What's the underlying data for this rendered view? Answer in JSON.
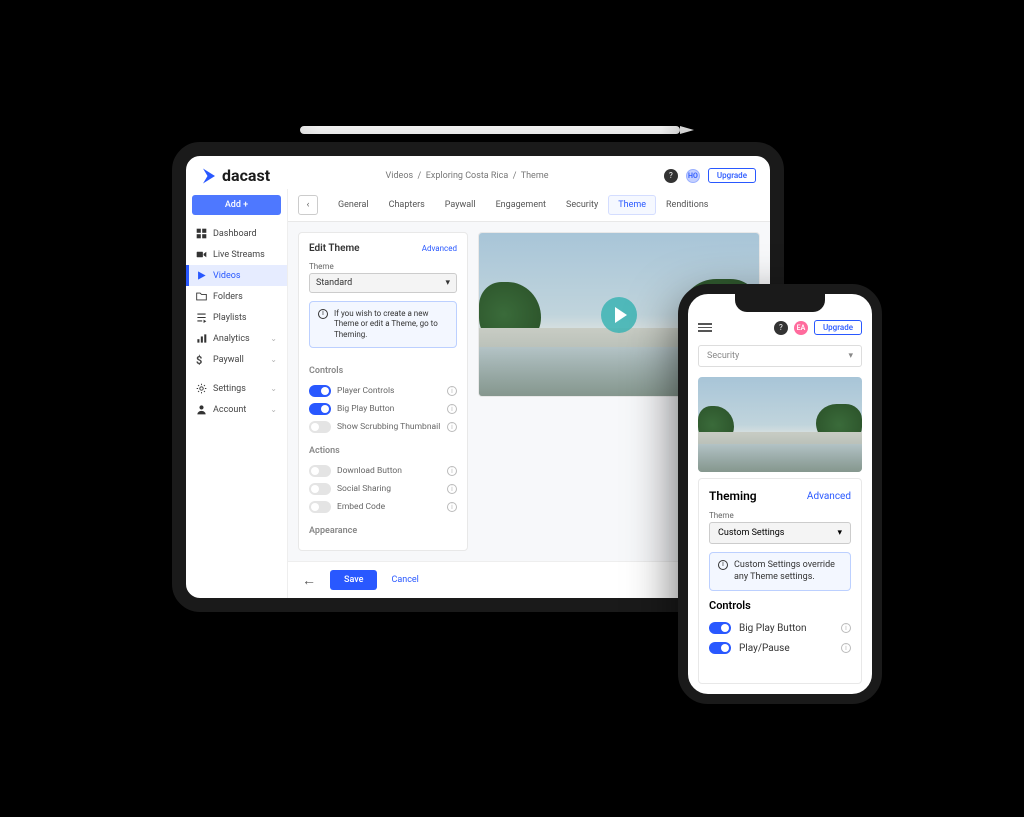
{
  "brand": "dacast",
  "breadcrumb": [
    "Videos",
    "Exploring Costa Rica",
    "Theme"
  ],
  "header": {
    "upgrade": "Upgrade",
    "user_initials": "HO"
  },
  "sidebar": {
    "add": "Add +",
    "items": [
      {
        "label": "Dashboard",
        "icon": "grid"
      },
      {
        "label": "Live Streams",
        "icon": "camera"
      },
      {
        "label": "Videos",
        "icon": "play",
        "active": true
      },
      {
        "label": "Folders",
        "icon": "folder"
      },
      {
        "label": "Playlists",
        "icon": "list"
      },
      {
        "label": "Analytics",
        "icon": "bars",
        "expandable": true
      },
      {
        "label": "Paywall",
        "icon": "dollar",
        "expandable": true
      },
      {
        "label": "Settings",
        "icon": "gear",
        "expandable": true
      },
      {
        "label": "Account",
        "icon": "person",
        "expandable": true
      }
    ]
  },
  "tabs": [
    "General",
    "Chapters",
    "Paywall",
    "Engagement",
    "Security",
    "Theme",
    "Renditions"
  ],
  "active_tab": "Theme",
  "panel": {
    "title": "Edit Theme",
    "advanced": "Advanced",
    "theme_label": "Theme",
    "theme_value": "Standard",
    "info": "If you wish to create a new Theme or edit a Theme, go to Theming.",
    "sections": {
      "controls": {
        "title": "Controls",
        "items": [
          {
            "label": "Player Controls",
            "on": true
          },
          {
            "label": "Big Play Button",
            "on": true
          },
          {
            "label": "Show Scrubbing Thumbnail",
            "on": false,
            "disabled": true
          }
        ]
      },
      "actions": {
        "title": "Actions",
        "items": [
          {
            "label": "Download Button",
            "on": false,
            "disabled": true
          },
          {
            "label": "Social Sharing",
            "on": false,
            "disabled": true
          },
          {
            "label": "Embed Code",
            "on": false,
            "disabled": true
          }
        ]
      },
      "appearance": {
        "title": "Appearance"
      }
    }
  },
  "footer": {
    "save": "Save",
    "cancel": "Cancel"
  },
  "phone": {
    "upgrade": "Upgrade",
    "user_initials": "EA",
    "select_top": "Security",
    "card_title": "Theming",
    "advanced": "Advanced",
    "theme_label": "Theme",
    "theme_value": "Custom Settings",
    "info": "Custom Settings override any Theme settings.",
    "controls_title": "Controls",
    "controls": [
      {
        "label": "Big Play Button",
        "on": true
      },
      {
        "label": "Play/Pause",
        "on": true
      }
    ]
  }
}
